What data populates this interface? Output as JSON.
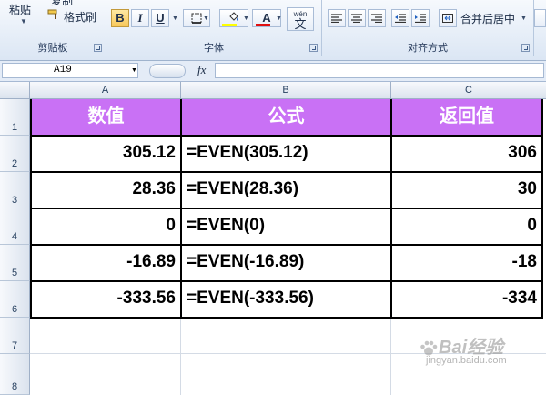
{
  "ribbon": {
    "clipboard": {
      "paste_label": "粘贴",
      "copy_label": "复制",
      "format_painter_label": "格式刷",
      "group_label": "剪贴板"
    },
    "font": {
      "bold_label": "B",
      "italic_label": "I",
      "underline_label": "U",
      "font_color_label": "A",
      "phonetic_top": "wén",
      "phonetic_char": "文",
      "group_label": "字体",
      "fill_color": "#ffff00",
      "text_color": "#e01010"
    },
    "alignment": {
      "merge_center_label": "合并后居中",
      "group_label": "对齐方式"
    }
  },
  "formula_bar": {
    "name_box": "A19",
    "fx_label": "fx",
    "formula": ""
  },
  "columns": [
    "A",
    "B",
    "C"
  ],
  "rows": [
    "1",
    "2",
    "3",
    "4",
    "5",
    "6",
    "7",
    "8"
  ],
  "table": {
    "headers": [
      "数值",
      "公式",
      "返回值"
    ],
    "rows": [
      {
        "value": "305.12",
        "formula": "=EVEN(305.12)",
        "result": "306"
      },
      {
        "value": "28.36",
        "formula": "=EVEN(28.36)",
        "result": "30"
      },
      {
        "value": "0",
        "formula": "=EVEN(0)",
        "result": "0"
      },
      {
        "value": "-16.89",
        "formula": "=EVEN(-16.89)",
        "result": "-18"
      },
      {
        "value": "-333.56",
        "formula": "=EVEN(-333.56)",
        "result": "-334"
      }
    ],
    "header_color": "#c971f5"
  },
  "watermark": {
    "main": "Bai经验",
    "sub": "jingyan.baidu.com"
  }
}
